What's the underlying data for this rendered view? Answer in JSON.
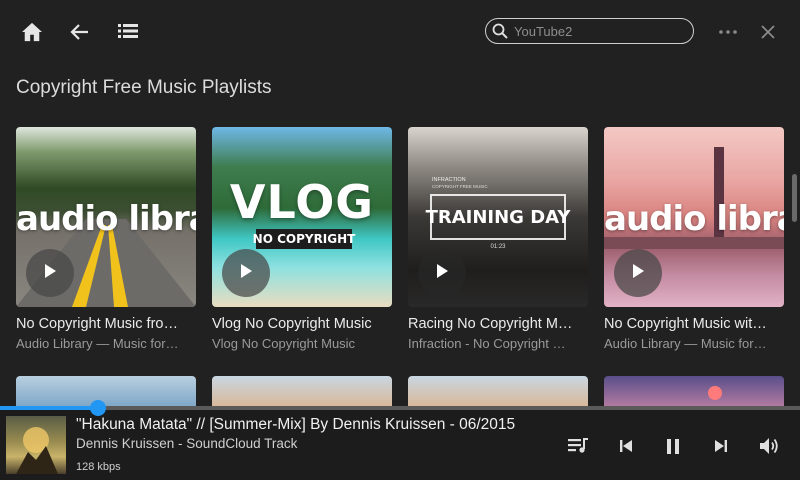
{
  "search": {
    "placeholder": "YouTube2"
  },
  "section": {
    "title": "Copyright Free Music Playlists"
  },
  "cards": [
    {
      "title": "No Copyright Music fro…",
      "subtitle": "Audio Library — Music for…",
      "overlay": "audio library"
    },
    {
      "title": "Vlog No Copyright Music",
      "subtitle": "Vlog No Copyright Music",
      "overlay": "VLOG",
      "overlay_sub": "NO COPYRIGHT"
    },
    {
      "title": "Racing No Copyright M…",
      "subtitle": "Infraction - No Copyright …",
      "overlay": "TRAINING DAY",
      "overlay_small": "INFRACTION",
      "overlay_small2": "COPYRIGHT FREE MUSIC",
      "overlay_time": "01:23"
    },
    {
      "title": "No Copyright Music wit…",
      "subtitle": "Audio Library — Music for…",
      "overlay": "audio library"
    }
  ],
  "player": {
    "title": "\"Hakuna Matata\" // [Summer-Mix] By Dennis Kruissen - 06/2015",
    "artist": "Dennis Kruissen - SoundCloud Track",
    "bitrate": "128 kbps",
    "progress": 0.122
  },
  "colors": {
    "accent": "#2196f3",
    "background": "#212121",
    "player_bg": "#1c1c1c"
  },
  "icons": [
    "home-icon",
    "back-arrow-icon",
    "list-icon",
    "search-icon",
    "more-icon",
    "close-icon",
    "queue-icon",
    "previous-icon",
    "pause-icon",
    "next-icon",
    "volume-icon",
    "play-icon"
  ]
}
